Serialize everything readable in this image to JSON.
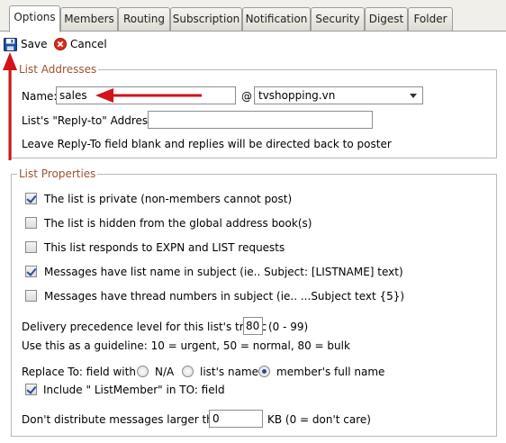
{
  "tabs": [
    {
      "label": "Options",
      "active": true
    },
    {
      "label": "Members"
    },
    {
      "label": "Routing"
    },
    {
      "label": "Subscription"
    },
    {
      "label": "Notification"
    },
    {
      "label": "Security"
    },
    {
      "label": "Digest"
    },
    {
      "label": "Folder"
    }
  ],
  "toolbar": {
    "save_label": "Save",
    "cancel_label": "Cancel"
  },
  "list_addresses": {
    "legend": "List Addresses",
    "name_label": "Name:",
    "name_value": "sales",
    "at_symbol": "@",
    "domain_value": "tvshopping.vn",
    "reply_to_label": "List's \"Reply-to\" Address:",
    "reply_to_value": "",
    "reply_to_hint": "Leave Reply-To field blank and replies will be directed back to poster"
  },
  "list_properties": {
    "legend": "List Properties",
    "options": [
      {
        "label": "The list is private (non-members cannot post)",
        "checked": true
      },
      {
        "label": "The list is hidden from the global address book(s)",
        "checked": false
      },
      {
        "label": "This list responds to EXPN and LIST requests",
        "checked": false
      },
      {
        "label": "Messages have list name in subject (ie.. Subject: [LISTNAME] text)",
        "checked": true
      },
      {
        "label": "Messages have thread numbers in subject (ie.. ...Subject text {5})",
        "checked": false
      }
    ],
    "precedence_label": "Delivery precedence level for this list's traffic",
    "precedence_value": "80",
    "precedence_range": "(0 - 99)",
    "guideline": "Use this as a guideline: 10 = urgent, 50 = normal, 80 = bulk",
    "replace_to_label": "Replace To: field with",
    "replace_to_options": [
      {
        "label": "N/A",
        "checked": false
      },
      {
        "label": "list's name",
        "checked": false
      },
      {
        "label": "member's full name",
        "checked": true
      }
    ],
    "include_listmember_label": "Include \" ListMember\" in TO: field",
    "include_listmember_checked": true,
    "max_size_label": "Don't distribute messages larger than",
    "max_size_value": "0",
    "max_size_unit": "KB (0 = don't care)"
  },
  "colors": {
    "annotation_arrow": "#d3121a",
    "legend_text": "#a0522d"
  }
}
